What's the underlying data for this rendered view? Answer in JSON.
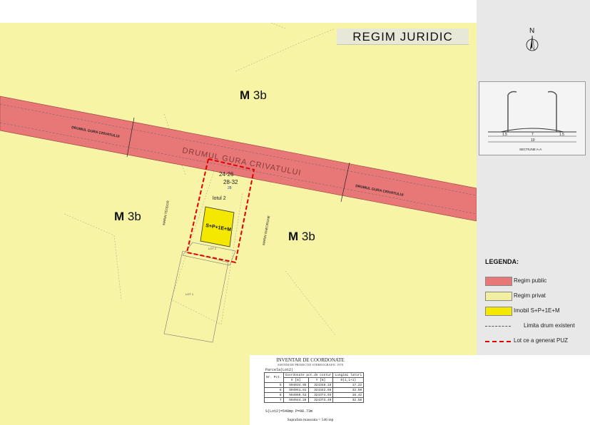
{
  "title": "REGIM  JURIDIC",
  "north": "N",
  "zones": {
    "top": {
      "bold": "M",
      "rest": " 3b"
    },
    "left": {
      "bold": "M",
      "rest": " 3b"
    },
    "right": {
      "bold": "M",
      "rest": " 3b"
    }
  },
  "road": {
    "label_center": "DRUMUL GURA CRIVATULUI",
    "label_left": "DRUMUL GURA CRIVATULUI",
    "label_right": "DRUMUL GURA CRIVATULUI"
  },
  "plot": {
    "address_1": "24-26",
    "address_2": "28-32",
    "number": "28",
    "lot_label": "lotul 2",
    "building": "S+P+1E+M",
    "lot2": "LOT 2",
    "lot1": "LOT 1",
    "street_left": "MARIN TEODOR",
    "street_right": "MARIN GHEORGHE"
  },
  "section": {
    "caption": "SECTIUNE A-A",
    "dim_left": "1.5",
    "dim_mid": "7",
    "dim_right": "1.5",
    "dim_total": "10"
  },
  "legend": {
    "title": "LEGENDA:",
    "items": [
      {
        "label": "Regim public",
        "color": "#e87878"
      },
      {
        "label": "Regim privat",
        "color": "#f2f0a0"
      },
      {
        "label": "Imobil S+P+1E+M",
        "color": "#f5e800"
      },
      {
        "label": "Limita drum existent",
        "color": "#555555"
      },
      {
        "label": "Lot ce a generat PUZ",
        "color": "#e00000"
      }
    ]
  },
  "inventar": {
    "title": "INVENTAR DE COORDONATE",
    "subtitle": "SISTEM DE PROIECTIE STEREOGRAFIC 1970",
    "parcel": "Parcela(Lot2)",
    "headers": [
      "Nr. Pct.",
      "X [m]",
      "Y [m]",
      "D(i,i+1)"
    ],
    "header_group": "Coordonate pct.de contur",
    "header_len": "Lungimi laturi",
    "rows": [
      [
        "5",
        "594934.95",
        "324348.19",
        "17.22"
      ],
      [
        "6",
        "594951.81",
        "324342.66",
        "32.50"
      ],
      [
        "6",
        "594960.52",
        "324374.03",
        "16.42"
      ],
      [
        "7",
        "594944.26",
        "324373.40",
        "32.58"
      ]
    ],
    "footer": "S(Lot2)=548mp  P=98.73m",
    "area": "Suprafata masurata = 546 mp"
  },
  "colors": {
    "public": "#e87878",
    "private": "#f7f4a6",
    "building": "#f5e800",
    "puz": "#e00000"
  }
}
